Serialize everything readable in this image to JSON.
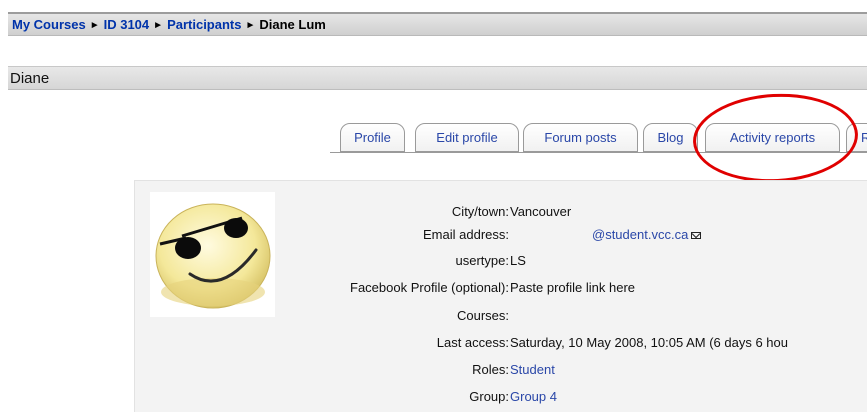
{
  "breadcrumb": {
    "items": [
      {
        "label": "My Courses"
      },
      {
        "label": "ID 3104"
      },
      {
        "label": "Participants"
      }
    ],
    "separator": "►",
    "current": "Diane Lum"
  },
  "heading": {
    "name": "Diane"
  },
  "tabs": [
    {
      "label": "Profile"
    },
    {
      "label": "Edit profile"
    },
    {
      "label": "Forum posts"
    },
    {
      "label": "Blog"
    },
    {
      "label": "Activity reports"
    },
    {
      "label": "R"
    }
  ],
  "profile": {
    "avatar_icon": "smiley-sunglasses-icon",
    "fields": [
      {
        "label": "City/town:",
        "value": "Vancouver"
      },
      {
        "label": "Email address:",
        "value": "@student.vcc.ca"
      },
      {
        "label": "usertype:",
        "value": "LS"
      },
      {
        "label": "Facebook Profile (optional):",
        "value": "Paste profile link here"
      },
      {
        "label": "Courses:",
        "value": ""
      },
      {
        "label": "Last access:",
        "value": "Saturday, 10 May 2008, 10:05 AM  (6 days 6 hou"
      },
      {
        "label": "Roles:",
        "value": "Student"
      },
      {
        "label": "Group:",
        "value": "Group 4"
      }
    ]
  },
  "colors": {
    "link": "#2a47a8",
    "highlight": "#e00000"
  }
}
